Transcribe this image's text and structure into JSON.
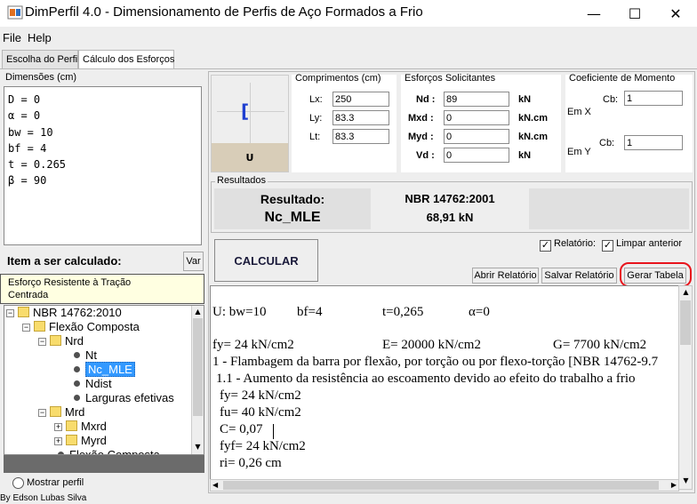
{
  "window": {
    "title": "DimPerfil 4.0 - Dimensionamento de Perfis de Aço Formados a Frio",
    "controls": {
      "minimize": "—",
      "maximize": "☐",
      "close": "✕"
    }
  },
  "menu": [
    "File",
    "Help"
  ],
  "tabs": [
    "Escolha do Perfil",
    "Cálculo dos Esforços"
  ],
  "dimensions": {
    "title": "Dimensões (cm)",
    "lines": [
      "D = 0",
      "α = 0",
      "bw = 10",
      "bf = 4",
      "t = 0.265",
      "β = 90"
    ]
  },
  "item": {
    "label": "Item a ser calculado:",
    "var_button": "Var",
    "tooltip_line1": "Esforço Resistente à Tração",
    "tooltip_line2": "Centrada"
  },
  "tree": {
    "root": "NBR 14762:2010",
    "flexao": "Flexão Composta",
    "nrd": "Nrd",
    "nt": "Nt",
    "nc_mle": "Nc_MLE",
    "ndist": "Ndist",
    "larguras": "Larguras efetivas",
    "mrd": "Mrd",
    "mxrd": "Mxrd",
    "myrd": "Myrd",
    "flexao2": "Flexão Composta"
  },
  "mostrar_perfil": "Mostrar perfil",
  "footer": "By Edson Lubas Silva",
  "profile_preview": {
    "section_glyph": "[",
    "label": "U"
  },
  "comprimentos": {
    "title": "Comprimentos (cm)",
    "lx_label": "Lx:",
    "lx": "250",
    "ly_label": "Ly:",
    "ly": "83.3",
    "lt_label": "Lt:",
    "lt": "83.3"
  },
  "esforcos": {
    "title": "Esforços Solicitantes",
    "nd_label": "Nd :",
    "nd": "89",
    "nd_unit": "kN",
    "mxd_label": "Mxd :",
    "mxd": "0",
    "mxd_unit": "kN.cm",
    "myd_label": "Myd :",
    "myd": "0",
    "myd_unit": "kN.cm",
    "vd_label": "Vd :",
    "vd": "0",
    "vd_unit": "kN"
  },
  "momento": {
    "title": "Coeficiente de Momento",
    "cb1_label": "Cb:",
    "cb1": "1",
    "em_x": "Em X",
    "cb2_label": "Cb:",
    "cb2": "1",
    "em_y": "Em Y"
  },
  "resultados": {
    "title": "Resultados",
    "resultado_label": "Resultado:",
    "resultado_value": "Nc_MLE",
    "norm_label": "NBR 14762:2001",
    "norm_value": "68,91 kN"
  },
  "options": {
    "relatorio": "Relatório:",
    "limpar": "Limpar anterior"
  },
  "buttons": {
    "calcular": "CALCULAR",
    "abrir": "Abrir Relatório",
    "salvar": "Salvar Relatório",
    "gerar": "Gerar Tabela"
  },
  "report": {
    "line1": {
      "u": "U: bw=10",
      "bf": "bf=4",
      "t": "t=0,265",
      "alpha": "α=0"
    },
    "line2": {
      "fy": "fy= 24 kN/cm2",
      "e": "E= 20000 kN/cm2",
      "g": "G= 7700 kN/cm2"
    },
    "lines": [
      "1 - Flambagem da barra por flexão, por torção ou por flexo-torção [NBR 14762-9.7",
      "1.1 - Aumento da resistência ao escoamento devido ao efeito do trabalho a frio",
      "fy= 24 kN/cm2",
      "fu= 40 kN/cm2",
      "C= 0,07",
      "fyf= 24 kN/cm2",
      "ri= 0,26 cm"
    ]
  },
  "colors": {
    "highlight": "#e8141c",
    "selected": "#3399ff",
    "tooltip": "#ffffe1"
  }
}
